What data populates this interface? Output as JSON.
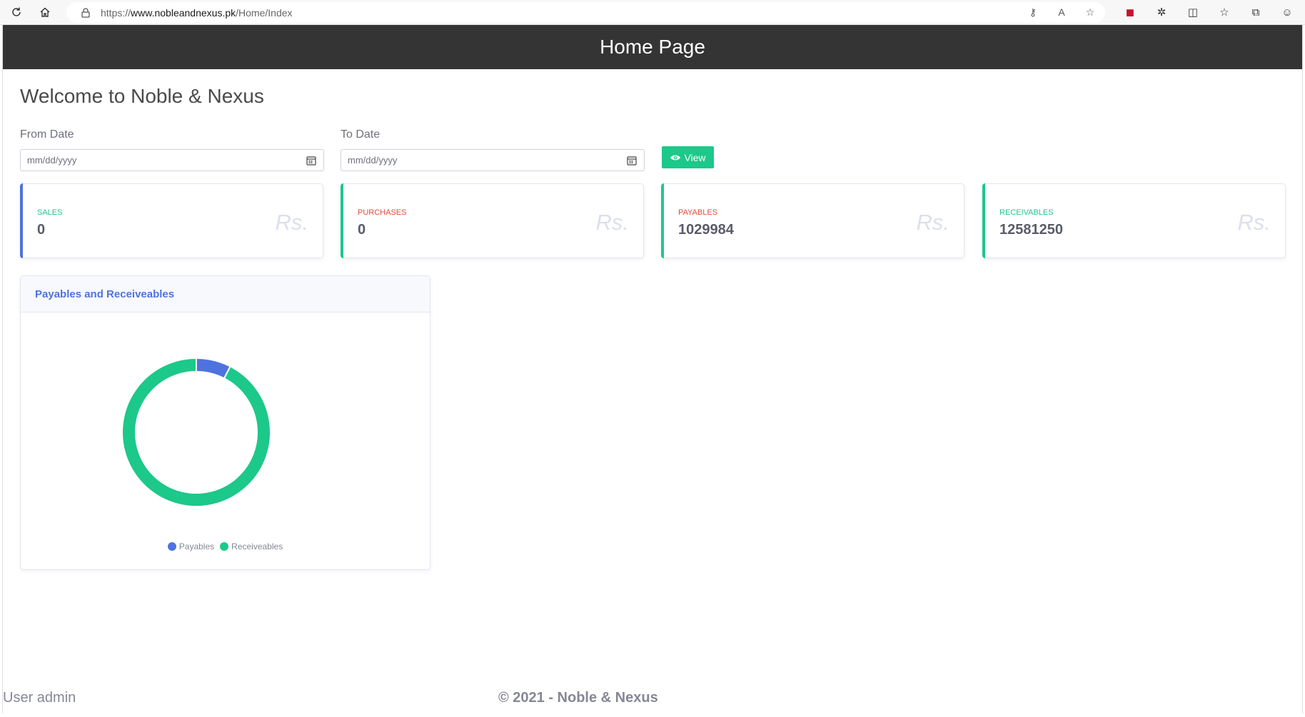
{
  "browser": {
    "url_prefix": "https://",
    "url_host": "www.nobleandnexus.pk",
    "url_path": "/Home/Index"
  },
  "header": {
    "title": "Home Page"
  },
  "welcome": "Welcome to Noble & Nexus",
  "filters": {
    "from_label": "From Date",
    "from_placeholder": "mm/dd/yyyy",
    "to_label": "To Date",
    "to_placeholder": "mm/dd/yyyy",
    "view_label": "View"
  },
  "cards": [
    {
      "label": "SALES",
      "value": "0",
      "currency": "Rs.",
      "color": "#4e73df",
      "label_color": "#1cc88a"
    },
    {
      "label": "PURCHASES",
      "value": "0",
      "currency": "Rs.",
      "color": "#1cc88a",
      "label_color": "#e74a3b"
    },
    {
      "label": "PAYABLES",
      "value": "1029984",
      "currency": "Rs.",
      "color": "#1cc88a",
      "label_color": "#e74a3b"
    },
    {
      "label": "RECEIVABLES",
      "value": "12581250",
      "currency": "Rs.",
      "color": "#1cc88a",
      "label_color": "#1cc88a"
    }
  ],
  "chart_title": "Payables and Receiveables",
  "chart_data": {
    "type": "pie",
    "donut": true,
    "title": "Payables and Receiveables",
    "categories": [
      "Payables",
      "Receiveables"
    ],
    "values": [
      1029984,
      12581250
    ],
    "colors": [
      "#4e73df",
      "#1cc88a"
    ],
    "legend": "bottom"
  },
  "footer": {
    "user": "User admin",
    "copyright": "© 2021 - Noble & Nexus"
  }
}
